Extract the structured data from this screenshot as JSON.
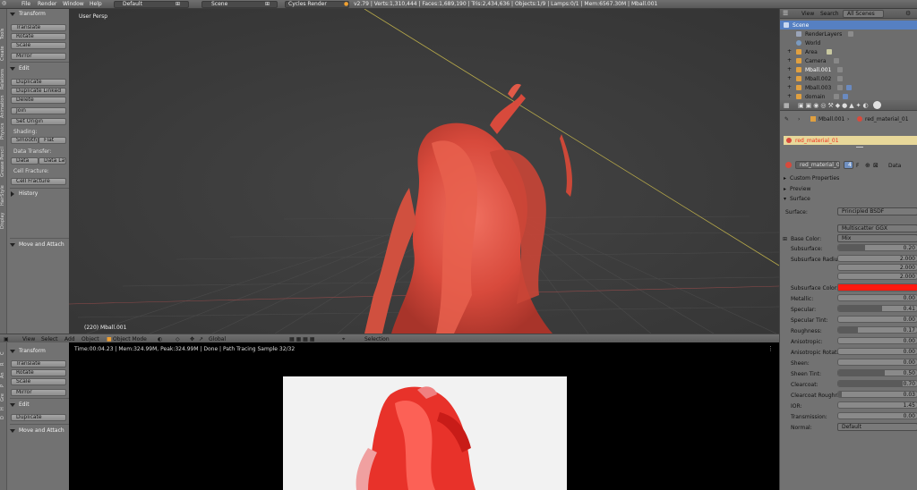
{
  "topbar": {
    "menus": [
      "File",
      "Render",
      "Window",
      "Help"
    ],
    "layout": "Default",
    "scene": "Scene",
    "engine": "Cycles Render",
    "stats": "v2.79 | Verts:1,310,444 | Faces:1,689,190 | Tris:2,434,636 | Objects:1/9 | Lamps:0/1 | Mem:6567.30M | Mball.001"
  },
  "toolshelf": {
    "tabs": [
      "Tools",
      "Create",
      "Relations",
      "Animation",
      "Physics",
      "Grease Pencil",
      "HairStyle",
      "Display"
    ],
    "transform_header": "Transform",
    "translate": "Translate",
    "rotate": "Rotate",
    "scale": "Scale",
    "mirror": "Mirror",
    "edit_header": "Edit",
    "duplicate": "Duplicate",
    "duplicate_linked": "Duplicate Linked",
    "delete": "Delete",
    "join": "Join",
    "set_origin": "Set Origin",
    "shading_label": "Shading:",
    "smooth": "Smooth",
    "flat": "Flat",
    "data_transfer_label": "Data Transfer:",
    "data": "Data",
    "data_layo": "Data Layo",
    "cell_fracture_label": "Cell Fracture:",
    "cell_fracture": "Cell Fracture",
    "history_header": "History",
    "move_attach": "Move and Attach"
  },
  "toolshelf2": {
    "tabs": [
      "C",
      "R",
      "An",
      "P",
      "Gre",
      "H",
      "D"
    ],
    "transform_header": "Transform",
    "translate": "Translate",
    "rotate": "Rotate",
    "scale": "Scale",
    "mirror": "Mirror",
    "edit_header": "Edit",
    "duplicate": "Duplicate",
    "move_attach": "Move and Attach"
  },
  "viewport": {
    "view_name": "User Persp",
    "object_label": "(220) Mball.001"
  },
  "viewheader": {
    "view": "View",
    "select": "Select",
    "add": "Add",
    "object": "Object",
    "mode": "Object Mode",
    "orientation": "Global",
    "selection": "Selection"
  },
  "render": {
    "status": "Time:00:04.23 | Mem:324.99M, Peak:324.99M | Done | Path Tracing Sample 32/32"
  },
  "outliner": {
    "view": "View",
    "search": "Search",
    "filter": "All Scenes",
    "rows": [
      {
        "name": "Scene",
        "icon": "scene-icon"
      },
      {
        "name": "RenderLayers",
        "icon": "renderlayers-icon"
      },
      {
        "name": "World",
        "icon": "world-icon"
      },
      {
        "name": "Area",
        "icon": "lamp-icon"
      },
      {
        "name": "Camera",
        "icon": "camera-icon"
      },
      {
        "name": "Mball.001",
        "icon": "metaball-icon"
      },
      {
        "name": "Mball.002",
        "icon": "metaball-icon"
      },
      {
        "name": "Mball.003",
        "icon": "metaball-icon"
      },
      {
        "name": "domain",
        "icon": "mesh-icon"
      }
    ]
  },
  "props": {
    "object": "Mball.001",
    "material": "red_material_01",
    "slot": "red_material_01",
    "users": "4",
    "fake": "F",
    "data": "Data",
    "custom_properties": "Custom Properties",
    "preview": "Preview",
    "surface_header": "Surface",
    "surface_label": "Surface:",
    "surface_value": "Principled BSDF",
    "distribution": "Multiscatter GGX",
    "base_color_label": "Base Color:",
    "base_color_value": "Mix",
    "subsurface_label": "Subsurface:",
    "subsurface_value": "0.20",
    "subsurface_radius_label": "Subsurface Radius:",
    "radius": [
      "2.000",
      "2.000",
      "2.000"
    ],
    "subsurface_color_label": "Subsurface Color:",
    "metallic_label": "Metallic:",
    "metallic_value": "0.00",
    "specular_label": "Specular:",
    "specular_value": "0.41",
    "specular_tint_label": "Specular Tint:",
    "specular_tint_value": "0.00",
    "roughness_label": "Roughness:",
    "roughness_value": "0.17",
    "anisotropic_label": "Anisotropic:",
    "anisotropic_value": "0.00",
    "anisotropic_rot_label": "Anisotropic Rotati...",
    "anisotropic_rot_value": "0.00",
    "sheen_label": "Sheen:",
    "sheen_value": "0.00",
    "sheen_tint_label": "Sheen Tint:",
    "sheen_tint_value": "0.50",
    "clearcoat_label": "Clearcoat:",
    "clearcoat_value": "0.70",
    "clearcoat_rough_label": "Clearcoat Roughn...",
    "clearcoat_rough_value": "0.03",
    "ior_label": "IOR:",
    "ior_value": "1.45",
    "transmission_label": "Transmission:",
    "transmission_value": "0.00",
    "normal_label": "Normal:",
    "normal_value": "Default"
  },
  "colors": {
    "accent": "#f0a030",
    "subsurface_color": "#ff1a10",
    "selected_row": "#5680c2",
    "material_bar": "#e8d89a"
  }
}
